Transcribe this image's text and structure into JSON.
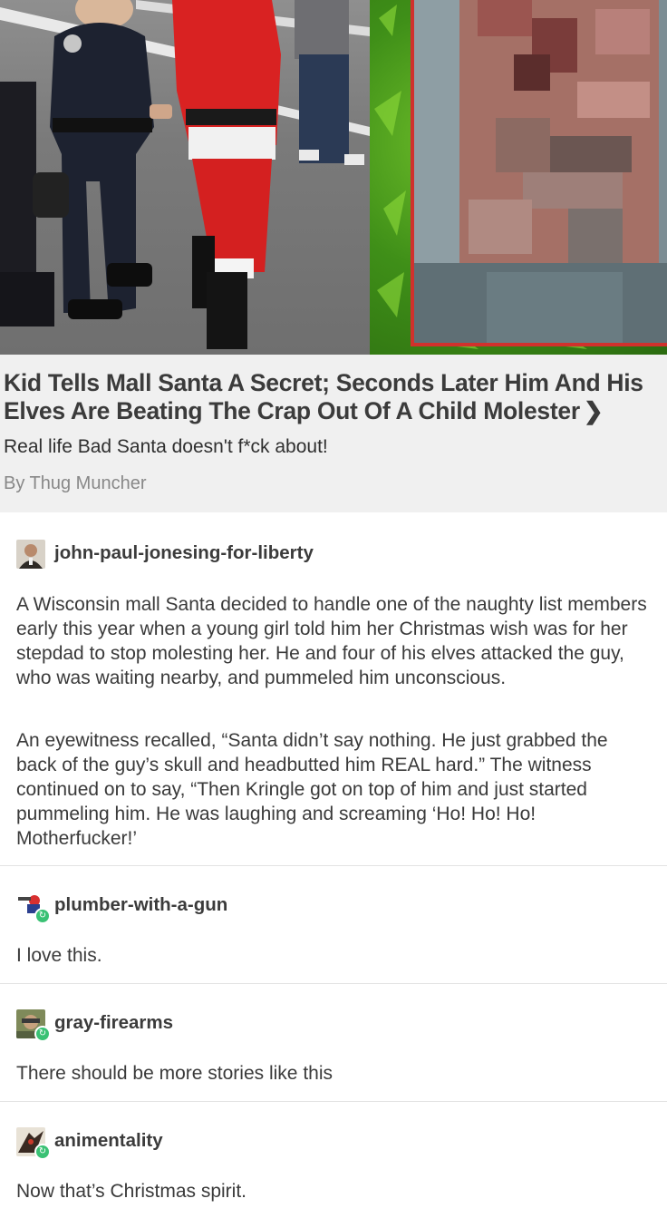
{
  "article": {
    "title": "Kid Tells Mall Santa A Secret; Seconds Later Him And His Elves Are Beating The Crap Out Of A Child Molester",
    "chevron_icon": "chevron-right-icon",
    "subtitle": "Real life Bad Santa doesn't f*ck about!",
    "byline": "By Thug Muncher"
  },
  "posts": [
    {
      "username": "john-paul-jonesing-for-liberty",
      "reblog_badge": false,
      "paragraphs": [
        "A Wisconsin mall Santa decided to handle one of the naughty list members early this year when a young girl told him her Christmas wish was for her stepdad to stop molesting her. He and four of his elves attacked the guy, who was waiting nearby, and pummeled him unconscious.",
        "An eyewitness recalled, “Santa didn’t say nothing. He just grabbed the back of the guy’s skull and headbutted him REAL hard.” The witness continued on to say, “Then Kringle got on top of him and just started pummeling him. He was laughing and screaming ‘Ho! Ho! Ho! Motherfucker!’"
      ]
    },
    {
      "username": "plumber-with-a-gun",
      "reblog_badge": true,
      "paragraphs": [
        "I love this."
      ]
    },
    {
      "username": "gray-firearms",
      "reblog_badge": true,
      "paragraphs": [
        "There should be more stories like this"
      ]
    },
    {
      "username": "animentality",
      "reblog_badge": true,
      "paragraphs": [
        "Now that’s Christmas spirit."
      ]
    }
  ],
  "colors": {
    "card_bg": "#f0f0f0",
    "reblog_green": "#3ac174",
    "mugshot_border": "#d0312d",
    "username": "#3b3b3b",
    "byline": "#888888"
  }
}
